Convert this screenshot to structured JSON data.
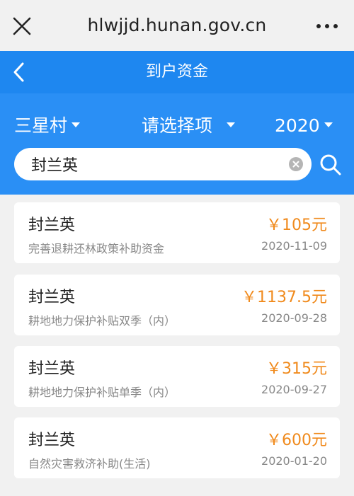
{
  "browser": {
    "url": "hlwjjd.hunan.gov.cn",
    "close_icon": "close-icon",
    "menu_icon": "more-icon"
  },
  "header": {
    "title": "到户资金",
    "back_icon": "chevron-left-icon",
    "color": "#1e87f0"
  },
  "filters": {
    "village": "三星村",
    "item": "请选择项",
    "year": "2020"
  },
  "search": {
    "value": "封兰英",
    "clear_icon": "clear-icon",
    "search_icon": "search-icon"
  },
  "records": [
    {
      "name": "封兰英",
      "amount": "￥105元",
      "desc": "完善退耕还林政策补助资金",
      "date": "2020-11-09"
    },
    {
      "name": "封兰英",
      "amount": "￥1137.5元",
      "desc": "耕地地力保护补贴双季（内）",
      "date": "2020-09-28"
    },
    {
      "name": "封兰英",
      "amount": "￥315元",
      "desc": "耕地地力保护补贴单季（内）",
      "date": "2020-09-27"
    },
    {
      "name": "封兰英",
      "amount": "￥600元",
      "desc": "自然灾害救济补助(生活)",
      "date": "2020-01-20"
    }
  ],
  "colors": {
    "accent": "#2a8ff5",
    "amount": "#f08a1c"
  }
}
